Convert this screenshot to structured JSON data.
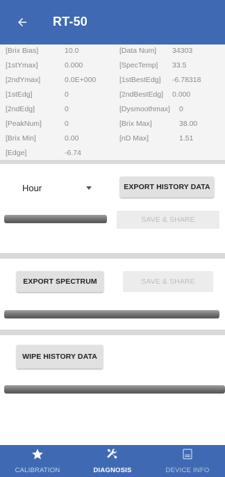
{
  "header": {
    "title": "RT-50",
    "back_icon": "arrow-left-icon"
  },
  "diagnostics": {
    "rows": [
      [
        {
          "label": "[Brix Bias]",
          "value": "10.0"
        },
        {
          "label": "[Data Num]",
          "value": "34303"
        }
      ],
      [
        {
          "label": "[1stYmax]",
          "value": "0.000"
        },
        {
          "label": "[SpecTemp]",
          "value": "33.5"
        }
      ],
      [
        {
          "label": "[2ndYmax]",
          "value": "0.0E+000"
        },
        {
          "label": "[1stBestEdg]",
          "value": "-6.78318"
        }
      ],
      [
        {
          "label": "[1stEdg]",
          "value": "0"
        },
        {
          "label": "[2ndBestEdg]",
          "value": "0.000"
        }
      ],
      [
        {
          "label": "[2ndEdg]",
          "value": "0"
        },
        {
          "label": "[Dysmoothmax]",
          "value": "0"
        }
      ],
      [
        {
          "label": "[PeakNum]",
          "value": "0"
        },
        {
          "label": "[Brix Max]",
          "value": "38.00"
        }
      ],
      [
        {
          "label": "[Brix Min]",
          "value": "0.00"
        },
        {
          "label": "[nD Max]",
          "value": "1.51"
        }
      ],
      [
        {
          "label": "[Edge]",
          "value": "-6.74"
        }
      ]
    ]
  },
  "history": {
    "period_selected": "Hour",
    "export_label": "EXPORT HISTORY DATA",
    "save_share_label": "SAVE & SHARE"
  },
  "spectrum": {
    "export_label": "EXPORT SPECTRUM",
    "save_share_label": "SAVE & SHARE"
  },
  "wipe": {
    "label": "WIPE HISTORY DATA"
  },
  "bottom_nav": {
    "items": [
      {
        "label": "CALIBRATION",
        "icon": "star-icon"
      },
      {
        "label": "DIAGNOSIS",
        "icon": "tools-icon"
      },
      {
        "label": "DEVICE INFO",
        "icon": "device-info-icon"
      }
    ]
  },
  "colors": {
    "primary": "#3f6ab3",
    "panel": "#f4f4f4",
    "separator": "#d9d9d9"
  }
}
